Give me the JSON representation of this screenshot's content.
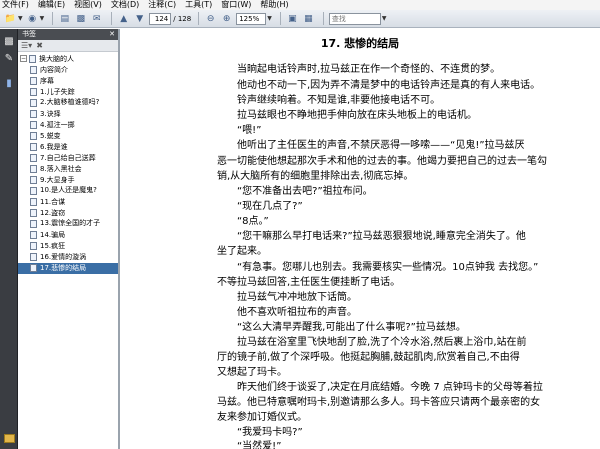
{
  "menu": [
    "文件(F)",
    "编辑(E)",
    "视图(V)",
    "文档(D)",
    "注释(C)",
    "工具(T)",
    "窗口(W)",
    "帮助(H)"
  ],
  "toolbar": {
    "page_current": "124",
    "page_total": "/ 128",
    "zoom": "125%",
    "search_placeholder": "查找"
  },
  "panel": {
    "title": "书签",
    "root": "换大脑的人",
    "items": [
      "内容简介",
      "序幕",
      "1.儿子失踪",
      "2.大脑移植谁德吗?",
      "3.诀择",
      "4.孤注一掷",
      "5.蜕变",
      "6.我是谁",
      "7.自己给自己送葬",
      "8.落入黑社会",
      "9.大显身手",
      "10.是人还是魔鬼?",
      "11.合谋",
      "12.盗窃",
      "13.震惊全国的才子",
      "14.骗局",
      "15.疯狂",
      "16.爱情的漩涡",
      "17.悲惨的结局"
    ]
  },
  "document": {
    "title": "17. 悲惨的结局",
    "lines": [
      "当晌起电话铃声时,拉马兹正在作一个奇怪的、不连贯的梦。",
      "他动也不动一下,因为弄不清是梦中的电话铃声还是真的有人来电话。",
      "铃声继续响着。不知是谁,非要他接电话不可。",
      "拉马兹眼也不睁地把手伸向放在床头地板上的电话机。",
      "“喂!”",
      "他听出了主任医生的声音,不禁厌恶得一哆嗦——“见鬼!”拉马兹厌",
      "恶一切能使他想起那次手术和他的过去的事。他竭力要把自己的过去一笔勾",
      "销,从大脑所有的细胞里排除出去,彻底忘掉。",
      "“您不准备出去吧?”祖拉布问。",
      "“现在几点了?”",
      "“8点。”",
      "“您干嘛那么早打电话来?”拉马兹恶狠狠地说,睡意完全消失了。他",
      "坐了起来。",
      "“有急事。您哪儿也别去。我需要核实一些情况。10点钟我 去找您。”",
      "不等拉马兹回答,主任医生便挂断了电话。",
      "拉马兹气冲冲地放下话筒。",
      "他不喜欢听祖拉布的声音。",
      "“这么大清早弄醒我,可能出了什么事呢?”拉马兹想。",
      "拉马兹在浴室里飞快地刮了脸,洗了个冷水浴,然后裹上浴巾,站在前",
      "厅的镜子前,做了个深呼吸。他挺起胸脯,鼓起肌肉,欣赏着自己,不由得",
      "又想起了玛卡。",
      "昨天他们终于谈妥了,决定在月底结婚。今晚 7 点钟玛卡的父母等着拉",
      "马兹。他已特意嘱咐玛卡,别邀请那么多人。玛卡答应只请两个最亲密的女",
      "友来参加订婚仪式。",
      "“我爱玛卡吗?”",
      "“当然爱!”"
    ]
  }
}
